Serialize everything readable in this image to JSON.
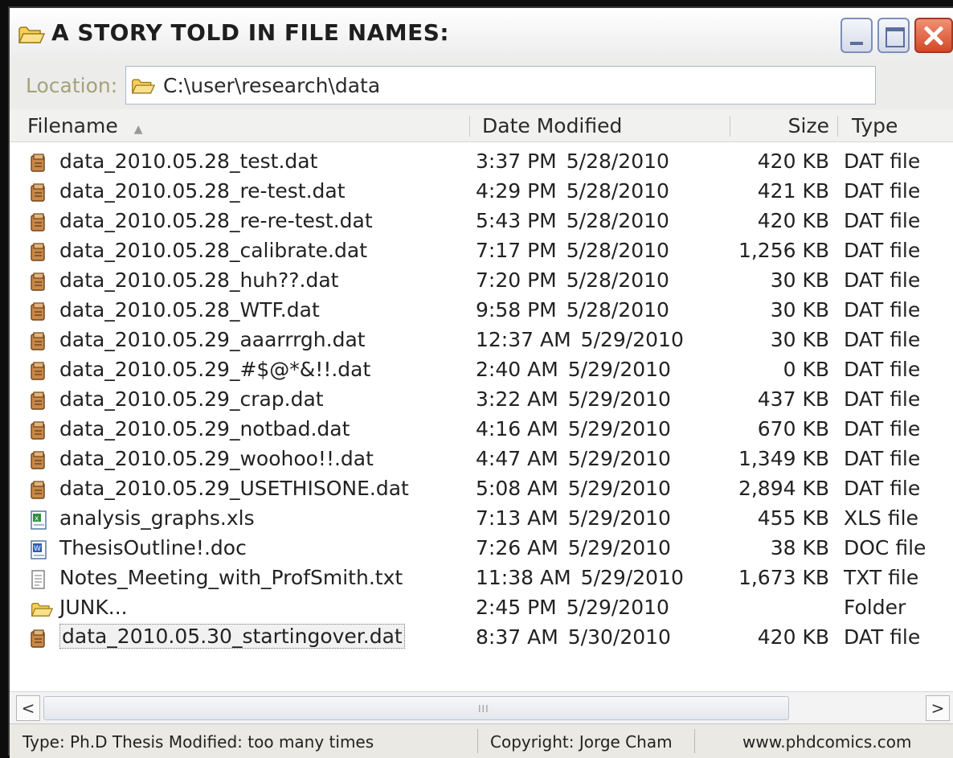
{
  "window": {
    "title": "A STORY TOLD IN FILE NAMES:"
  },
  "location": {
    "label": "Location:",
    "path": "C:\\user\\research\\data",
    "dropdown": "⌄"
  },
  "columns": {
    "filename": "Filename",
    "date": "Date Modified",
    "size": "Size",
    "type": "Type"
  },
  "files": [
    {
      "icon": "dat-file-icon",
      "name": "data_2010.05.28_test.dat",
      "time": "3:37 PM",
      "date": "5/28/2010",
      "size": "420 KB",
      "type": "DAT file"
    },
    {
      "icon": "dat-file-icon",
      "name": "data_2010.05.28_re-test.dat",
      "time": "4:29 PM",
      "date": "5/28/2010",
      "size": "421 KB",
      "type": "DAT file"
    },
    {
      "icon": "dat-file-icon",
      "name": "data_2010.05.28_re-re-test.dat",
      "time": "5:43 PM",
      "date": "5/28/2010",
      "size": "420 KB",
      "type": "DAT file"
    },
    {
      "icon": "dat-file-icon",
      "name": "data_2010.05.28_calibrate.dat",
      "time": "7:17 PM",
      "date": "5/28/2010",
      "size": "1,256 KB",
      "type": "DAT file"
    },
    {
      "icon": "dat-file-icon",
      "name": "data_2010.05.28_huh??.dat",
      "time": "7:20 PM",
      "date": "5/28/2010",
      "size": "30 KB",
      "type": "DAT file"
    },
    {
      "icon": "dat-file-icon",
      "name": "data_2010.05.28_WTF.dat",
      "time": "9:58 PM",
      "date": "5/28/2010",
      "size": "30 KB",
      "type": "DAT file"
    },
    {
      "icon": "dat-file-icon",
      "name": "data_2010.05.29_aaarrrgh.dat",
      "time": "12:37 AM",
      "date": "5/29/2010",
      "size": "30 KB",
      "type": "DAT file"
    },
    {
      "icon": "dat-file-icon",
      "name": "data_2010.05.29_#$@*&!!.dat",
      "time": "2:40 AM",
      "date": "5/29/2010",
      "size": "0 KB",
      "type": "DAT file"
    },
    {
      "icon": "dat-file-icon",
      "name": "data_2010.05.29_crap.dat",
      "time": "3:22 AM",
      "date": "5/29/2010",
      "size": "437 KB",
      "type": "DAT file"
    },
    {
      "icon": "dat-file-icon",
      "name": "data_2010.05.29_notbad.dat",
      "time": "4:16 AM",
      "date": "5/29/2010",
      "size": "670 KB",
      "type": "DAT file"
    },
    {
      "icon": "dat-file-icon",
      "name": "data_2010.05.29_woohoo!!.dat",
      "time": "4:47 AM",
      "date": "5/29/2010",
      "size": "1,349 KB",
      "type": "DAT file"
    },
    {
      "icon": "dat-file-icon",
      "name": "data_2010.05.29_USETHISONE.dat",
      "time": "5:08 AM",
      "date": "5/29/2010",
      "size": "2,894 KB",
      "type": "DAT file"
    },
    {
      "icon": "xls-file-icon",
      "name": "analysis_graphs.xls",
      "time": "7:13 AM",
      "date": "5/29/2010",
      "size": "455 KB",
      "type": "XLS file"
    },
    {
      "icon": "doc-file-icon",
      "name": "ThesisOutline!.doc",
      "time": "7:26 AM",
      "date": "5/29/2010",
      "size": "38 KB",
      "type": "DOC file"
    },
    {
      "icon": "txt-file-icon",
      "name": "Notes_Meeting_with_ProfSmith.txt",
      "time": "11:38 AM",
      "date": "5/29/2010",
      "size": "1,673 KB",
      "type": "TXT file"
    },
    {
      "icon": "folder-icon",
      "name": "JUNK...",
      "time": "2:45 PM",
      "date": "5/29/2010",
      "size": "",
      "type": "Folder"
    },
    {
      "icon": "dat-file-icon",
      "name": "data_2010.05.30_startingover.dat",
      "time": "8:37 AM",
      "date": "5/30/2010",
      "size": "420 KB",
      "type": "DAT file",
      "selected": true
    }
  ],
  "scrollbar": {
    "left": "<",
    "right": ">",
    "grip": "III"
  },
  "status": {
    "info": "Type: Ph.D Thesis  Modified: too many times",
    "copyright": "Copyright: Jorge Cham",
    "website": "www.phdcomics.com"
  }
}
